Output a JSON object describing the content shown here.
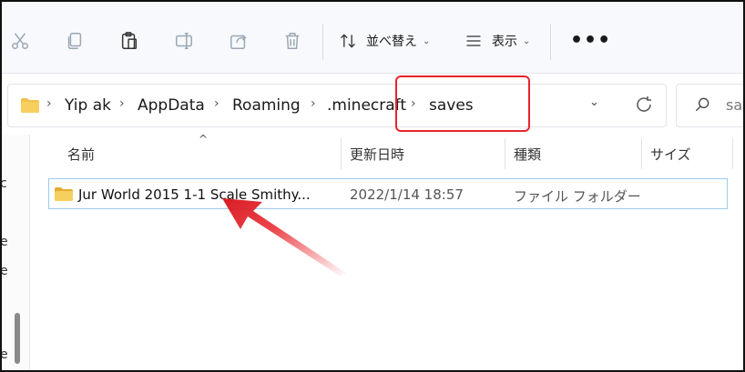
{
  "toolbar": {
    "sort_label": "並べ替え",
    "view_label": "表示",
    "more_label": "•••"
  },
  "address": {
    "crumbs": [
      "Yip ak",
      "AppData",
      "Roaming",
      ".minecraft",
      "saves"
    ]
  },
  "search": {
    "placeholder": "sav"
  },
  "nav": {
    "fragments": [
      "c",
      "e",
      "e",
      "e"
    ]
  },
  "columns": {
    "name": "名前",
    "date": "更新日時",
    "type": "種類",
    "size": "サイズ"
  },
  "rows": [
    {
      "name": "Jur World 2015 1-1 Scale Smithy...",
      "date": "2022/1/14 18:57",
      "type": "ファイル フォルダー",
      "size": ""
    }
  ],
  "colors": {
    "highlight": "#e8242c",
    "folder": "#f2c14e",
    "selection_border": "#9ccbef"
  },
  "icons": [
    "cut-icon",
    "copy-icon",
    "paste-icon",
    "rename-icon",
    "share-icon",
    "delete-icon",
    "sort-icon",
    "view-icon",
    "folder-icon",
    "refresh-icon",
    "search-icon"
  ]
}
